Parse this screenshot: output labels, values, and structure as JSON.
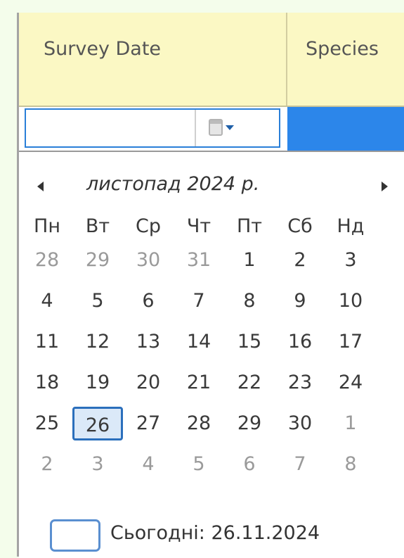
{
  "grid": {
    "columns": [
      {
        "label": "Survey Date"
      },
      {
        "label": "Species"
      }
    ]
  },
  "filter": {
    "date_value": "",
    "calendar_icon": "calendar-icon",
    "dropdown_icon": "chevron-down-icon"
  },
  "calendar": {
    "month_label": "листопад 2024 р.",
    "prev_icon": "arrow-left-icon",
    "next_icon": "arrow-right-icon",
    "weekdays": [
      "Пн",
      "Вт",
      "Ср",
      "Чт",
      "Пт",
      "Сб",
      "Нд"
    ],
    "weeks": [
      [
        {
          "d": "28",
          "other": true
        },
        {
          "d": "29",
          "other": true
        },
        {
          "d": "30",
          "other": true
        },
        {
          "d": "31",
          "other": true
        },
        {
          "d": "1"
        },
        {
          "d": "2"
        },
        {
          "d": "3"
        }
      ],
      [
        {
          "d": "4"
        },
        {
          "d": "5"
        },
        {
          "d": "6"
        },
        {
          "d": "7"
        },
        {
          "d": "8"
        },
        {
          "d": "9"
        },
        {
          "d": "10"
        }
      ],
      [
        {
          "d": "11"
        },
        {
          "d": "12"
        },
        {
          "d": "13"
        },
        {
          "d": "14"
        },
        {
          "d": "15"
        },
        {
          "d": "16"
        },
        {
          "d": "17"
        }
      ],
      [
        {
          "d": "18"
        },
        {
          "d": "19"
        },
        {
          "d": "20"
        },
        {
          "d": "21"
        },
        {
          "d": "22"
        },
        {
          "d": "23"
        },
        {
          "d": "24"
        }
      ],
      [
        {
          "d": "25"
        },
        {
          "d": "26",
          "selected": true
        },
        {
          "d": "27"
        },
        {
          "d": "28"
        },
        {
          "d": "29"
        },
        {
          "d": "30"
        },
        {
          "d": "1",
          "other": true
        }
      ],
      [
        {
          "d": "2",
          "other": true
        },
        {
          "d": "3",
          "other": true
        },
        {
          "d": "4",
          "other": true
        },
        {
          "d": "5",
          "other": true
        },
        {
          "d": "6",
          "other": true
        },
        {
          "d": "7",
          "other": true
        },
        {
          "d": "8",
          "other": true
        }
      ]
    ],
    "today_label": "Сьогодні: 26.11.2024"
  },
  "colors": {
    "header_bg": "#fbf8c4",
    "selected_row": "#2c86ea",
    "today_border": "#5a8fd0"
  }
}
